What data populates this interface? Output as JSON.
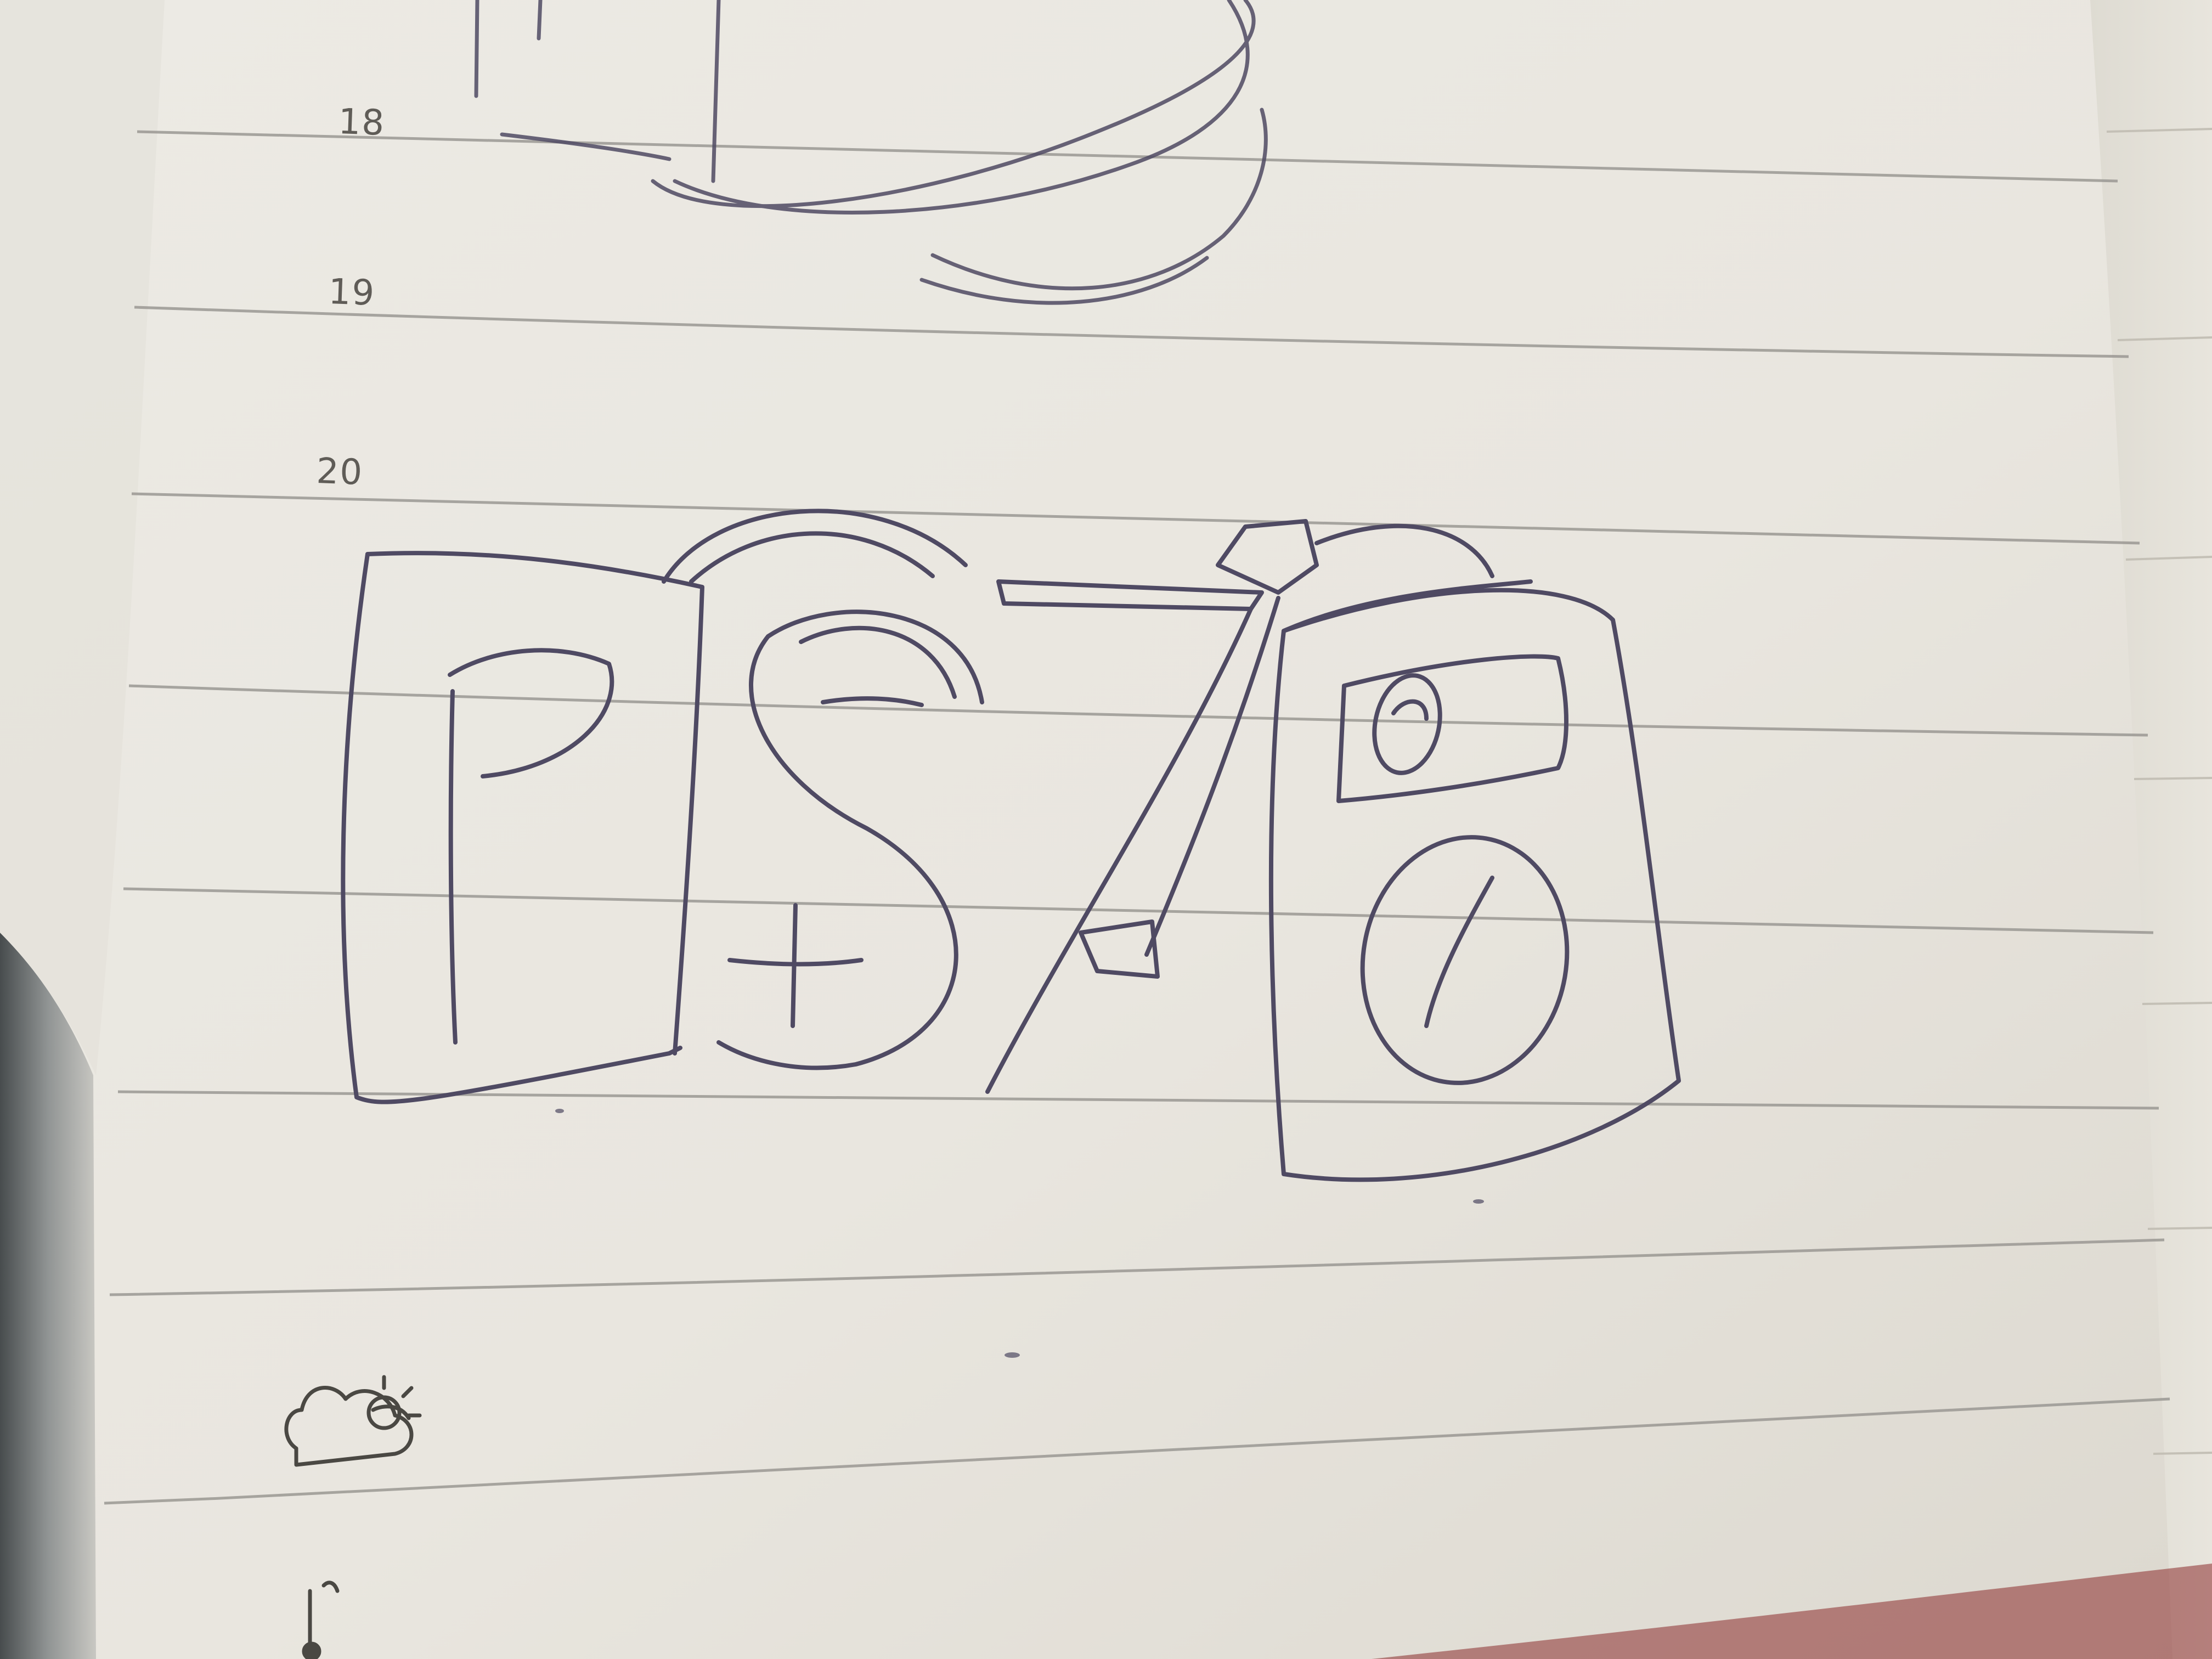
{
  "notebook": {
    "line_numbers": [
      "18",
      "19",
      "20"
    ],
    "icons": [
      "partly-cloudy-icon",
      "thermometer-icon"
    ],
    "colors": {
      "paper": "#ebe8e1",
      "rule_line": "#9a9893",
      "pencil_ink": "#4f4a63",
      "edge_shadow": "#6b6f70",
      "cover_red": "#8a2b2b"
    }
  },
  "sketch": {
    "subject": "hand-drawn-pencil-sketch-logo"
  }
}
